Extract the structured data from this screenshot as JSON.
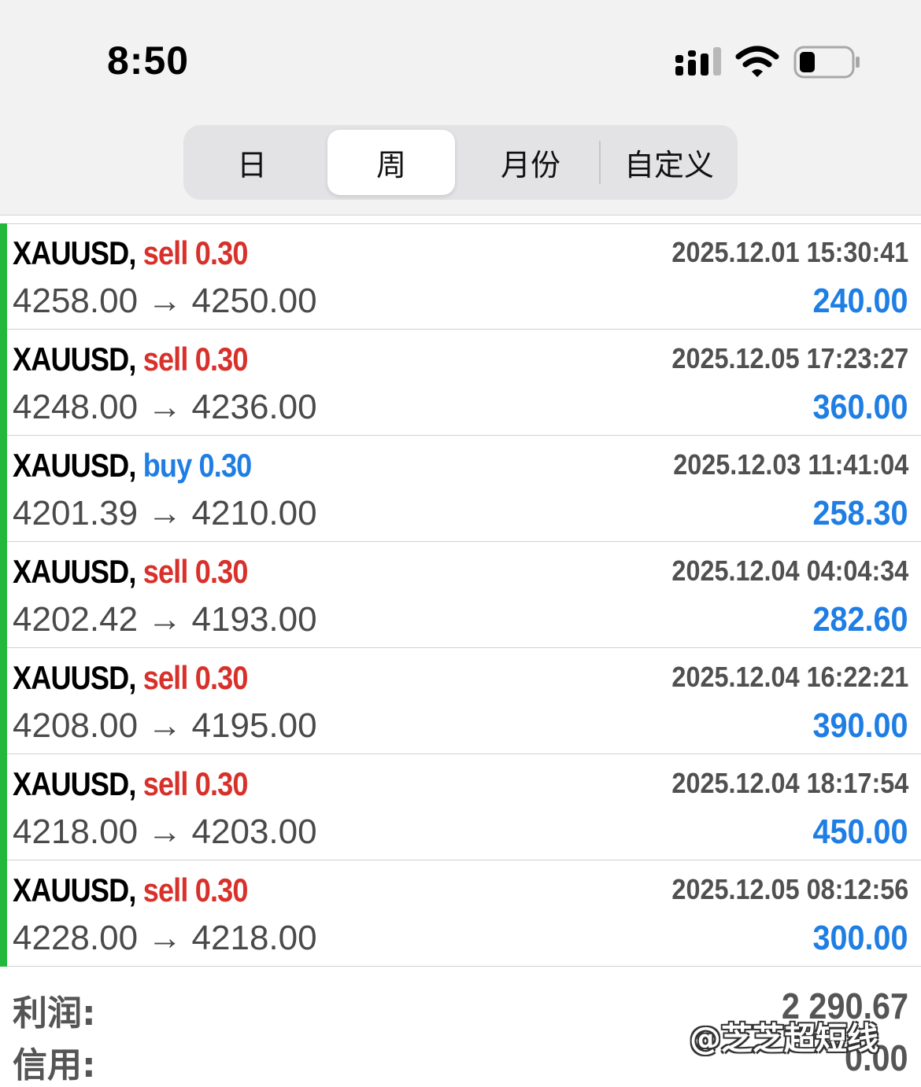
{
  "status_bar": {
    "time": "8:50",
    "battery_level": 0.25
  },
  "segmented_control": {
    "tabs": [
      {
        "label": "日",
        "active": false
      },
      {
        "label": "周",
        "active": true
      },
      {
        "label": "月份",
        "active": false
      },
      {
        "label": "自定义",
        "active": false
      }
    ]
  },
  "colors": {
    "sell": "#d8302a",
    "buy": "#1f7ee3",
    "profit": "#1f7ee3",
    "row_indicator": "#22b83c"
  },
  "trades": [
    {
      "symbol": "XAUUSD,",
      "side": "sell",
      "volume": "0.30",
      "datetime": "2025.12.01 15:30:41",
      "open": "4258.00",
      "close": "4250.00",
      "arrow": "→",
      "profit": "240.00"
    },
    {
      "symbol": "XAUUSD,",
      "side": "sell",
      "volume": "0.30",
      "datetime": "2025.12.05 17:23:27",
      "open": "4248.00",
      "close": "4236.00",
      "arrow": "→",
      "profit": "360.00"
    },
    {
      "symbol": "XAUUSD,",
      "side": "buy",
      "volume": "0.30",
      "datetime": "2025.12.03 11:41:04",
      "open": "4201.39",
      "close": "4210.00",
      "arrow": "→",
      "profit": "258.30"
    },
    {
      "symbol": "XAUUSD,",
      "side": "sell",
      "volume": "0.30",
      "datetime": "2025.12.04 04:04:34",
      "open": "4202.42",
      "close": "4193.00",
      "arrow": "→",
      "profit": "282.60"
    },
    {
      "symbol": "XAUUSD,",
      "side": "sell",
      "volume": "0.30",
      "datetime": "2025.12.04 16:22:21",
      "open": "4208.00",
      "close": "4195.00",
      "arrow": "→",
      "profit": "390.00"
    },
    {
      "symbol": "XAUUSD,",
      "side": "sell",
      "volume": "0.30",
      "datetime": "2025.12.04 18:17:54",
      "open": "4218.00",
      "close": "4203.00",
      "arrow": "→",
      "profit": "450.00"
    },
    {
      "symbol": "XAUUSD,",
      "side": "sell",
      "volume": "0.30",
      "datetime": "2025.12.05 08:12:56",
      "open": "4228.00",
      "close": "4218.00",
      "arrow": "→",
      "profit": "300.00"
    }
  ],
  "summary": {
    "profit_label": "利润:",
    "profit_value": "2 290.67",
    "credit_label": "信用:",
    "credit_value": "0.00"
  },
  "watermark": "@芝芝超短线"
}
